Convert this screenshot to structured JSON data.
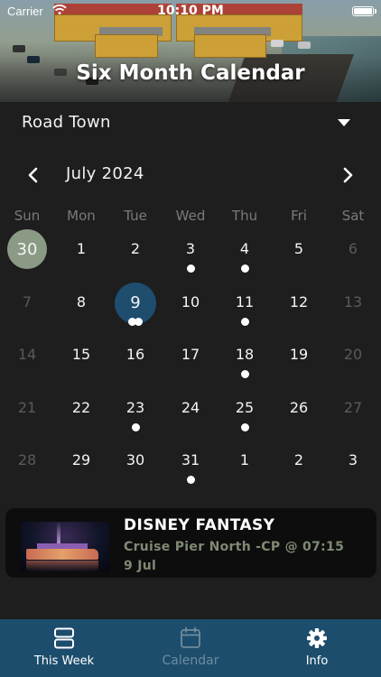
{
  "status_bar": {
    "carrier": "Carrier",
    "time": "10:10 PM"
  },
  "header": {
    "title": "Six Month Calendar"
  },
  "location": {
    "selected": "Road Town"
  },
  "calendar": {
    "month_label": "July 2024",
    "weekdays": [
      "Sun",
      "Mon",
      "Tue",
      "Wed",
      "Thu",
      "Fri",
      "Sat"
    ],
    "weeks": [
      [
        {
          "day": "30",
          "muted": false,
          "dots": 0,
          "state": "today"
        },
        {
          "day": "1",
          "muted": false,
          "dots": 0
        },
        {
          "day": "2",
          "muted": false,
          "dots": 0
        },
        {
          "day": "3",
          "muted": false,
          "dots": 1
        },
        {
          "day": "4",
          "muted": false,
          "dots": 1
        },
        {
          "day": "5",
          "muted": false,
          "dots": 0
        },
        {
          "day": "6",
          "muted": true,
          "dots": 0
        }
      ],
      [
        {
          "day": "7",
          "muted": true,
          "dots": 0
        },
        {
          "day": "8",
          "muted": false,
          "dots": 0
        },
        {
          "day": "9",
          "muted": false,
          "dots": 2,
          "state": "selected"
        },
        {
          "day": "10",
          "muted": false,
          "dots": 0
        },
        {
          "day": "11",
          "muted": false,
          "dots": 1
        },
        {
          "day": "12",
          "muted": false,
          "dots": 0
        },
        {
          "day": "13",
          "muted": true,
          "dots": 0
        }
      ],
      [
        {
          "day": "14",
          "muted": true,
          "dots": 0
        },
        {
          "day": "15",
          "muted": false,
          "dots": 0
        },
        {
          "day": "16",
          "muted": false,
          "dots": 0
        },
        {
          "day": "17",
          "muted": false,
          "dots": 0
        },
        {
          "day": "18",
          "muted": false,
          "dots": 1
        },
        {
          "day": "19",
          "muted": false,
          "dots": 0
        },
        {
          "day": "20",
          "muted": true,
          "dots": 0
        }
      ],
      [
        {
          "day": "21",
          "muted": true,
          "dots": 0
        },
        {
          "day": "22",
          "muted": false,
          "dots": 0
        },
        {
          "day": "23",
          "muted": false,
          "dots": 1
        },
        {
          "day": "24",
          "muted": false,
          "dots": 0
        },
        {
          "day": "25",
          "muted": false,
          "dots": 1
        },
        {
          "day": "26",
          "muted": false,
          "dots": 0
        },
        {
          "day": "27",
          "muted": true,
          "dots": 0
        }
      ],
      [
        {
          "day": "28",
          "muted": true,
          "dots": 0
        },
        {
          "day": "29",
          "muted": false,
          "dots": 0
        },
        {
          "day": "30",
          "muted": false,
          "dots": 0
        },
        {
          "day": "31",
          "muted": false,
          "dots": 1
        },
        {
          "day": "1",
          "muted": false,
          "dots": 0
        },
        {
          "day": "2",
          "muted": false,
          "dots": 0
        },
        {
          "day": "3",
          "muted": false,
          "dots": 0
        }
      ]
    ]
  },
  "event": {
    "ship_name": "DISNEY FANTASY",
    "detail": "Cruise Pier North -CP  @  07:15",
    "date": "9 Jul"
  },
  "tabs": [
    {
      "label": "This Week",
      "icon": "this-week-icon",
      "active": true
    },
    {
      "label": "Calendar",
      "icon": "calendar-icon",
      "active": false
    },
    {
      "label": "Info",
      "icon": "gear-icon",
      "active": true
    }
  ],
  "colors": {
    "background": "#1e1e1e",
    "tab_bar": "#1d4d6c",
    "today_circle": "#8a9a84",
    "selected_circle": "#1e4d6e",
    "event_detail": "#7f8a74"
  }
}
